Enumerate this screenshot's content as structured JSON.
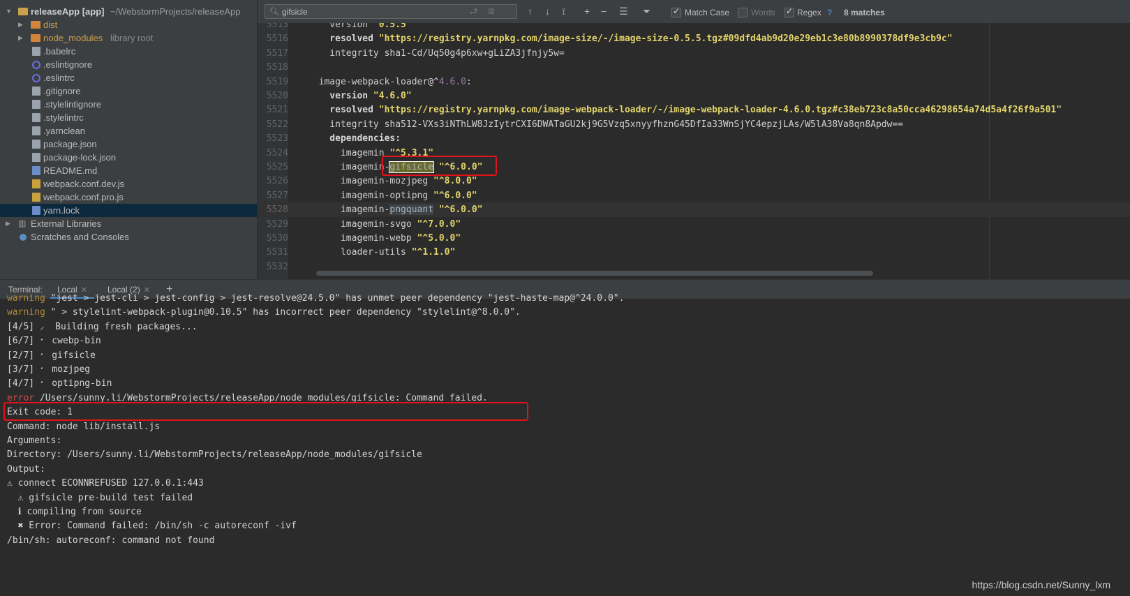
{
  "project": {
    "root_name": "releaseApp [app]",
    "root_path": "~/WebstormProjects/releaseApp",
    "items": [
      {
        "label": "dist",
        "type": "folder"
      },
      {
        "label": "node_modules",
        "note": "library root",
        "type": "folder"
      },
      {
        "label": ".babelrc",
        "type": "file"
      },
      {
        "label": ".eslintignore",
        "type": "circle"
      },
      {
        "label": ".eslintrc",
        "type": "circle"
      },
      {
        "label": ".gitignore",
        "type": "file"
      },
      {
        "label": ".stylelintignore",
        "type": "shield"
      },
      {
        "label": ".stylelintrc",
        "type": "shield"
      },
      {
        "label": ".yarnclean",
        "type": "file"
      },
      {
        "label": "package.json",
        "type": "file"
      },
      {
        "label": "package-lock.json",
        "type": "file"
      },
      {
        "label": "README.md",
        "type": "md"
      },
      {
        "label": "webpack.conf.dev.js",
        "type": "js"
      },
      {
        "label": "webpack.conf.pro.js",
        "type": "js"
      },
      {
        "label": "yarn.lock",
        "type": "yarn"
      }
    ],
    "external_libraries": "External Libraries",
    "scratches": "Scratches and Consoles"
  },
  "search": {
    "query": "gifsicle",
    "match_case": "Match Case",
    "words": "Words",
    "regex": "Regex",
    "help": "?",
    "matches": "8 matches"
  },
  "editor": {
    "lines": [
      {
        "n": "5515",
        "segs": [
          [
            "key",
            "    version "
          ],
          [
            "str",
            "\"0.5.5\""
          ]
        ]
      },
      {
        "n": "5516",
        "segs": [
          [
            "bkey",
            "    resolved "
          ],
          [
            "str",
            "\"https://registry.yarnpkg.com/image-size/-/image-size-0.5.5.tgz#09dfd4ab9d20e29eb1c3e80b8990378df9e3cb9c\""
          ]
        ]
      },
      {
        "n": "5517",
        "segs": [
          [
            "key",
            "    integrity sha1-Cd/Uq50g4p6xw+gLiZA3jfnjy5w="
          ]
        ]
      },
      {
        "n": "5518",
        "segs": []
      },
      {
        "n": "5519",
        "segs": [
          [
            "key",
            "  image-webpack-loader@^"
          ],
          [
            "purple",
            "4.6.0"
          ],
          [
            "key",
            ":"
          ]
        ]
      },
      {
        "n": "5520",
        "segs": [
          [
            "bkey",
            "    version "
          ],
          [
            "str",
            "\"4.6.0\""
          ]
        ]
      },
      {
        "n": "5521",
        "segs": [
          [
            "bkey",
            "    resolved "
          ],
          [
            "str",
            "\"https://registry.yarnpkg.com/image-webpack-loader/-/image-webpack-loader-4.6.0.tgz#c38eb723c8a50cca46298654a74d5a4f26f9a501\""
          ]
        ]
      },
      {
        "n": "5522",
        "segs": [
          [
            "key",
            "    integrity sha512-VXs3iNThLW8JzIytrCXI6DWATaGU2kj9G5Vzq5xnyyfhznG45DfIa33WnSjYC4epzjLAs/W5lA38Va8qn8Apdw=="
          ]
        ]
      },
      {
        "n": "5523",
        "segs": [
          [
            "bkey",
            "    dependencies:"
          ]
        ]
      },
      {
        "n": "5524",
        "segs": [
          [
            "key",
            "      imagemin "
          ],
          [
            "str",
            "\"^5.3.1\""
          ]
        ]
      },
      {
        "n": "5525",
        "segs": [
          [
            "key",
            "      imagemin-"
          ],
          [
            "hl",
            "gifsicle"
          ],
          [
            "key",
            " "
          ],
          [
            "str",
            "\"^6.0.0\""
          ]
        ]
      },
      {
        "n": "5526",
        "segs": [
          [
            "key",
            "      imagemin-mozjpeg "
          ],
          [
            "str",
            "\"^8.0.0\""
          ]
        ]
      },
      {
        "n": "5527",
        "segs": [
          [
            "key",
            "      imagemin-optipng "
          ],
          [
            "str",
            "\"^6.0.0\""
          ]
        ]
      },
      {
        "n": "5528",
        "segs": [
          [
            "key",
            "      imagemin-"
          ],
          [
            "hl2",
            "pngquant"
          ],
          [
            "key",
            " "
          ],
          [
            "str",
            "\"^6.0.0\""
          ]
        ]
      },
      {
        "n": "5529",
        "segs": [
          [
            "key",
            "      imagemin-svgo "
          ],
          [
            "str",
            "\"^7.0.0\""
          ]
        ]
      },
      {
        "n": "5530",
        "segs": [
          [
            "key",
            "      imagemin-webp "
          ],
          [
            "str",
            "\"^5.0.0\""
          ]
        ]
      },
      {
        "n": "5531",
        "segs": [
          [
            "key",
            "      loader-utils "
          ],
          [
            "str",
            "\"^1.1.0\""
          ]
        ]
      },
      {
        "n": "5532",
        "segs": []
      }
    ]
  },
  "terminal": {
    "label": "Terminal:",
    "tabs": [
      "Local",
      "Local (2)"
    ],
    "add": "+",
    "lines": [
      [
        [
          "warn",
          "warning"
        ],
        [
          "t",
          " \"jest > jest-cli > jest-config > jest-resolve@24.5.0\" has unmet peer dependency \"jest-haste-map@^24.0.0\"."
        ]
      ],
      [
        [
          "warn",
          "warning"
        ],
        [
          "t",
          " \" > stylelint-webpack-plugin@0.10.5\" has incorrect peer dependency \"stylelint@^8.0.0\"."
        ]
      ],
      [
        [
          "t",
          "[4/5] ⸝  Building fresh packages..."
        ]
      ],
      [
        [
          "t",
          "[6/7] ⠂ cwebp-bin"
        ]
      ],
      [
        [
          "t",
          "[2/7] ⠂ gifsicle"
        ]
      ],
      [
        [
          "t",
          "[3/7] ⠂ mozjpeg"
        ]
      ],
      [
        [
          "t",
          "[4/7] ⠂ optipng-bin"
        ]
      ],
      [
        [
          "err",
          "error"
        ],
        [
          "t",
          " /Users/sunny.li/WebstormProjects/releaseApp/node_modules/gifsicle: Command failed."
        ]
      ],
      [
        [
          "t",
          "Exit code: 1"
        ]
      ],
      [
        [
          "t",
          "Command: node lib/install.js"
        ]
      ],
      [
        [
          "t",
          "Arguments:"
        ]
      ],
      [
        [
          "t",
          "Directory: /Users/sunny.li/WebstormProjects/releaseApp/node_modules/gifsicle"
        ]
      ],
      [
        [
          "t",
          "Output:"
        ]
      ],
      [
        [
          "t",
          "⚠ connect ECONNREFUSED 127.0.0.1:443"
        ]
      ],
      [
        [
          "t",
          "  ⚠ gifsicle pre-build test failed"
        ]
      ],
      [
        [
          "t",
          "  ℹ compiling from source"
        ]
      ],
      [
        [
          "t",
          "  ✖ Error: Command failed: /bin/sh -c autoreconf -ivf"
        ]
      ],
      [
        [
          "t",
          "/bin/sh: autoreconf: command not found"
        ]
      ]
    ]
  },
  "watermark": "https://blog.csdn.net/Sunny_lxm"
}
